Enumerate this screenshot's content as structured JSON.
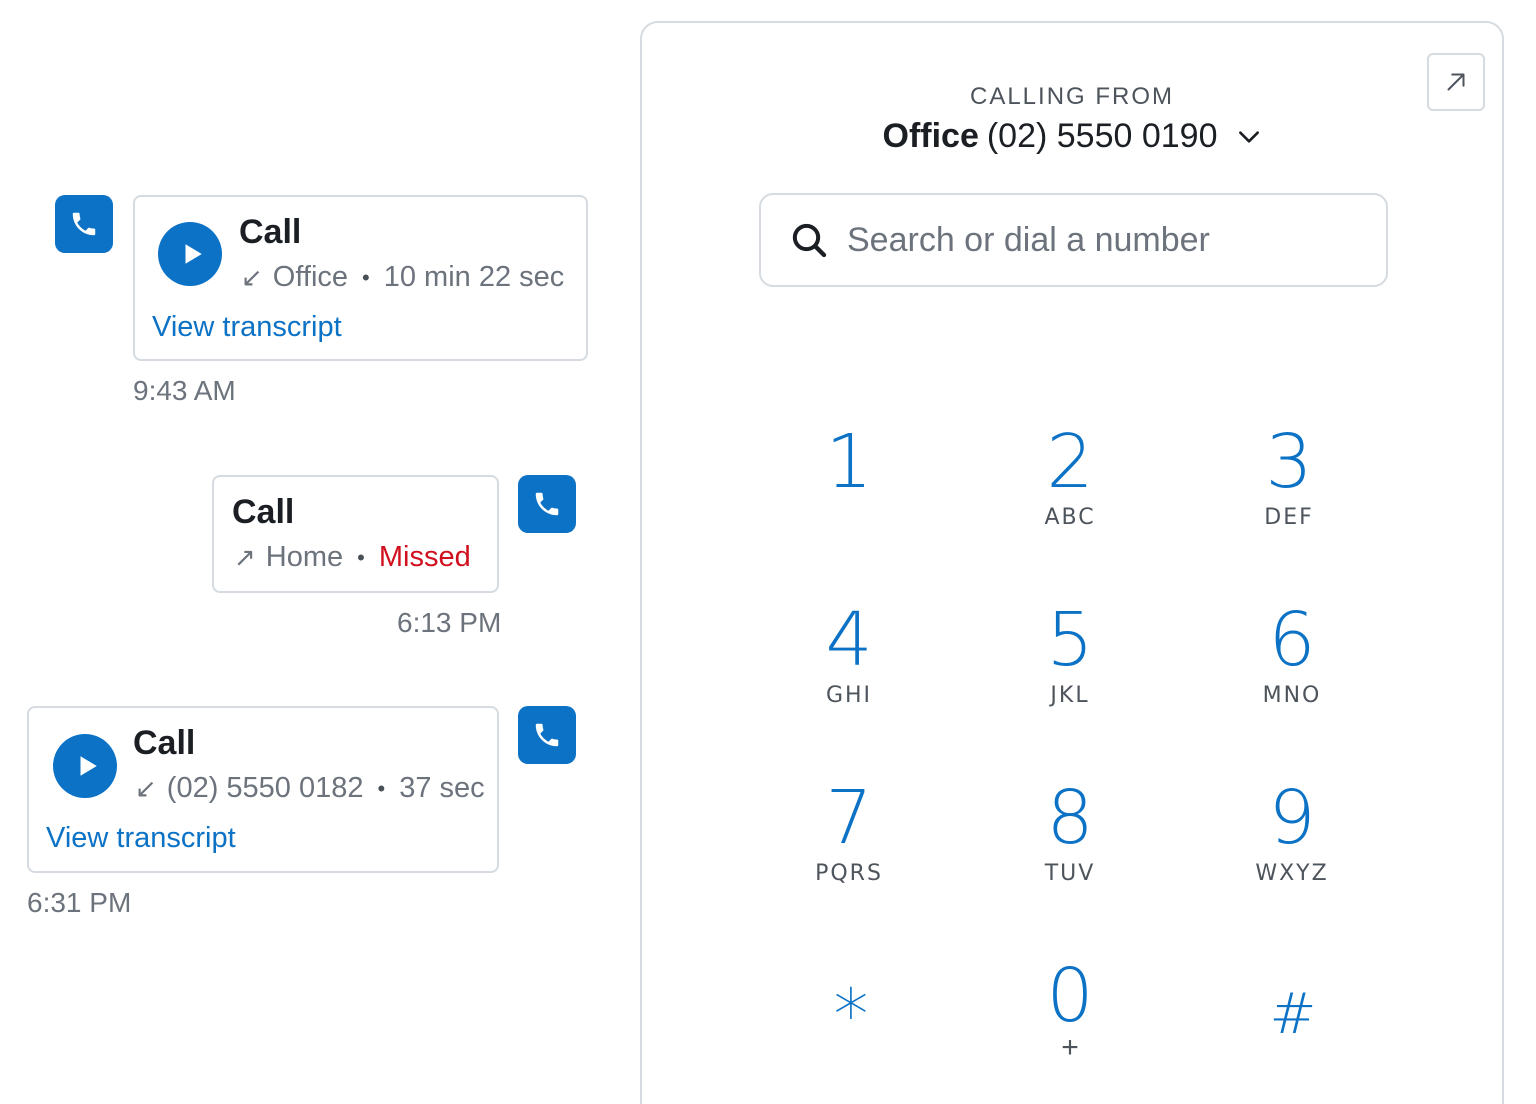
{
  "calls": [
    {
      "title": "Call",
      "direction_arrow": "↙",
      "line": "Office",
      "status": "10 min 22 sec",
      "link": "View transcript",
      "time": "9:43 AM"
    },
    {
      "title": "Call",
      "direction_arrow": "↗",
      "line": "Home",
      "status": "Missed",
      "time": "6:13 PM"
    },
    {
      "title": "Call",
      "direction_arrow": "↙",
      "line": "(02) 5550 0182",
      "status": "37 sec",
      "link": "View transcript",
      "time": "6:31 PM"
    }
  ],
  "dialer": {
    "calling_from_label": "CALLING FROM",
    "line_name": "Office",
    "line_number": "(02) 5550 0190",
    "search_placeholder": "Search or dial a number",
    "keys": [
      {
        "digit": "1",
        "letters": ""
      },
      {
        "digit": "2",
        "letters": "ABC"
      },
      {
        "digit": "3",
        "letters": "DEF"
      },
      {
        "digit": "4",
        "letters": "GHI"
      },
      {
        "digit": "5",
        "letters": "JKL"
      },
      {
        "digit": "6",
        "letters": "MNO"
      },
      {
        "digit": "7",
        "letters": "PQRS"
      },
      {
        "digit": "8",
        "letters": "TUV"
      },
      {
        "digit": "9",
        "letters": "WXYZ"
      },
      {
        "digit": "*",
        "letters": ""
      },
      {
        "digit": "0",
        "letters": "+"
      },
      {
        "digit": "#",
        "letters": ""
      }
    ]
  },
  "colors": {
    "accent": "#0b72c6",
    "missed": "#d0101f",
    "muted_text": "#6c737c",
    "border": "#d6dbe1"
  },
  "icons": {
    "call_type": "phone-icon",
    "play": "play-icon",
    "expand": "expand-arrow-icon",
    "search": "search-icon",
    "dropdown": "chevron-down-icon"
  }
}
